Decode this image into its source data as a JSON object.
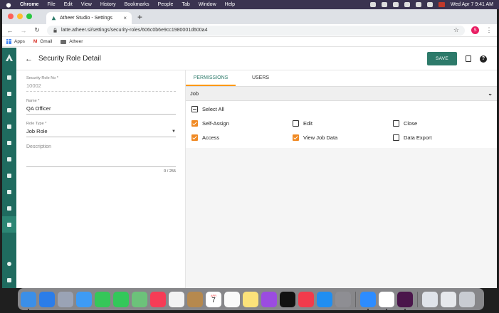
{
  "menubar": {
    "app": "Chrome",
    "items": [
      "File",
      "Edit",
      "View",
      "History",
      "Bookmarks",
      "People",
      "Tab",
      "Window",
      "Help"
    ],
    "datetime": "Wed Apr 7  9:41 AM"
  },
  "browser": {
    "tab_title": "Atheer Studio - Settings",
    "url": "latte.atheer.si/settings/security-roles/606c0b6e9cc1980001d600a4",
    "profile_initial": "S",
    "bookmarks": [
      "Apps",
      "Gmail",
      "Atheer"
    ]
  },
  "page": {
    "title": "Security Role Detail",
    "save_label": "SAVE"
  },
  "form": {
    "role_no_label": "Security Role No *",
    "role_no_value": "10002",
    "name_label": "Name *",
    "name_value": "QA Officer",
    "role_type_label": "Role Type *",
    "role_type_value": "Job Role",
    "description_placeholder": "Description",
    "counter": "0 / 255"
  },
  "panel": {
    "tabs": [
      "PERMISSIONS",
      "USERS"
    ],
    "active_tab": "PERMISSIONS",
    "section_title": "Job",
    "select_all_label": "Select All",
    "permissions": [
      {
        "label": "Self-Assign",
        "checked": true
      },
      {
        "label": "Edit",
        "checked": false
      },
      {
        "label": "Close",
        "checked": false
      },
      {
        "label": "Access",
        "checked": true
      },
      {
        "label": "View Job Data",
        "checked": true
      },
      {
        "label": "Data Export",
        "checked": false
      }
    ]
  },
  "dock": {
    "calendar_month": "APR",
    "calendar_day": "7",
    "apps": [
      "finder",
      "safari",
      "launchpad",
      "mail",
      "facetime",
      "messages",
      "maps",
      "music",
      "photos",
      "notes",
      "calendar",
      "reminders",
      "stickies",
      "podcasts",
      "tv",
      "news",
      "app-store",
      "system-preferences",
      "zoom",
      "chrome",
      "slack",
      "preview",
      "downloads",
      "trash"
    ]
  },
  "colors": {
    "accent": "#2d7a6a",
    "rail": "#1f6b5f",
    "checkbox": "#f08a24",
    "tab_indicator": "#ff9800"
  }
}
